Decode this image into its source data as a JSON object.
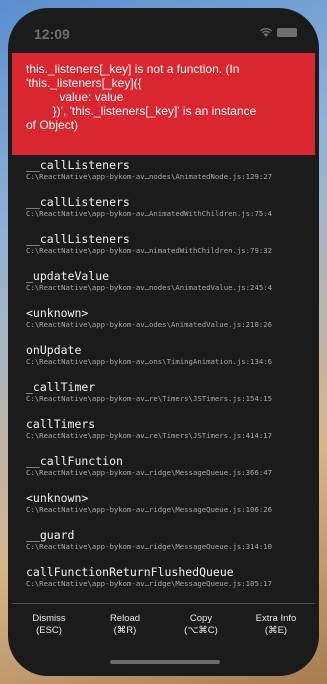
{
  "status_bar": {
    "time": "12:09"
  },
  "error": {
    "message": "this._listeners[_key] is not a function. (In\n'this._listeners[_key]({\n          value: value\n        })', 'this._listeners[_key]' is an instance\nof Object)"
  },
  "frames": [
    {
      "name": "__callListeners",
      "path": "C:\\ReactNative\\app-bykom-av…nodes\\AnimatedNode.js:129:27"
    },
    {
      "name": "__callListeners",
      "path": "C:\\ReactNative\\app-bykom-av…AnimatedWithChildren.js:75:4"
    },
    {
      "name": "__callListeners",
      "path": "C:\\ReactNative\\app-bykom-av…nimatedWithChildren.js:79:32"
    },
    {
      "name": "_updateValue",
      "path": "C:\\ReactNative\\app-bykom-av…nodes\\AnimatedValue.js:245:4"
    },
    {
      "name": "<unknown>",
      "path": "C:\\ReactNative\\app-bykom-av…odes\\AnimatedValue.js:210:26"
    },
    {
      "name": "onUpdate",
      "path": "C:\\ReactNative\\app-bykom-av…ons\\TimingAnimation.js:134:6"
    },
    {
      "name": "_callTimer",
      "path": "C:\\ReactNative\\app-bykom-av…re\\Timers\\JSTimers.js:154:15"
    },
    {
      "name": "callTimers",
      "path": "C:\\ReactNative\\app-bykom-av…re\\Timers\\JSTimers.js:414:17"
    },
    {
      "name": "__callFunction",
      "path": "C:\\ReactNative\\app-bykom-av…ridge\\MessageQueue.js:366:47"
    },
    {
      "name": "<unknown>",
      "path": "C:\\ReactNative\\app-bykom-av…ridge\\MessageQueue.js:106:26"
    },
    {
      "name": "__guard",
      "path": "C:\\ReactNative\\app-bykom-av…ridge\\MessageQueue.js:314:10"
    },
    {
      "name": "callFunctionReturnFlushedQueue",
      "path": "C:\\ReactNative\\app-bykom-av…ridge\\MessageQueue.js:105:17"
    }
  ],
  "footer": {
    "dismiss": {
      "label": "Dismiss",
      "shortcut": "(ESC)"
    },
    "reload": {
      "label": "Reload",
      "shortcut": "(⌘R)"
    },
    "copy": {
      "label": "Copy",
      "shortcut": "(⌥⌘C)"
    },
    "extra_info": {
      "label": "Extra Info",
      "shortcut": "(⌘E)"
    }
  },
  "icons": {
    "wifi": "wifi-icon",
    "battery": "battery-icon"
  },
  "colors": {
    "error_red": "#d9262f",
    "background": "#1b1b1b"
  }
}
